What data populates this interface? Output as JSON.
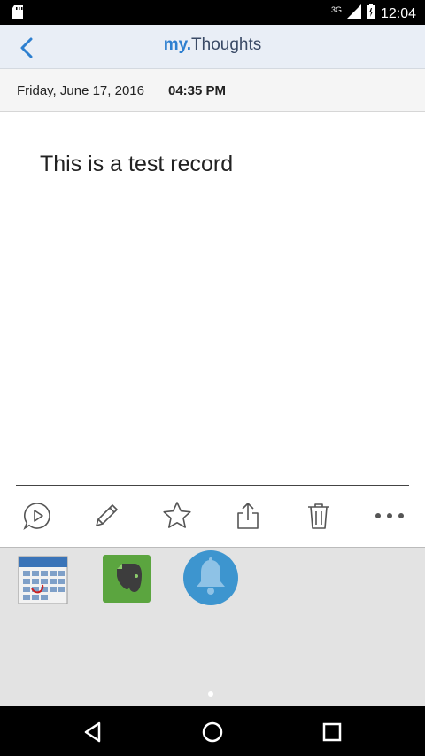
{
  "status_bar": {
    "network": "3G",
    "time": "12:04"
  },
  "header": {
    "logo_prefix": "my.",
    "logo_name": "Thoughts"
  },
  "record": {
    "date": "Friday, June 17, 2016",
    "time": "04:35 PM",
    "text": "This is a test record"
  },
  "toolbar": {
    "icons": [
      "play-icon",
      "pencil-icon",
      "star-icon",
      "share-icon",
      "trash-icon",
      "more-icon"
    ]
  },
  "tray": {
    "apps": [
      "calendar-app-icon",
      "evernote-app-icon",
      "reminder-bell-app-icon"
    ],
    "accent_color": "#2d7fd0"
  }
}
